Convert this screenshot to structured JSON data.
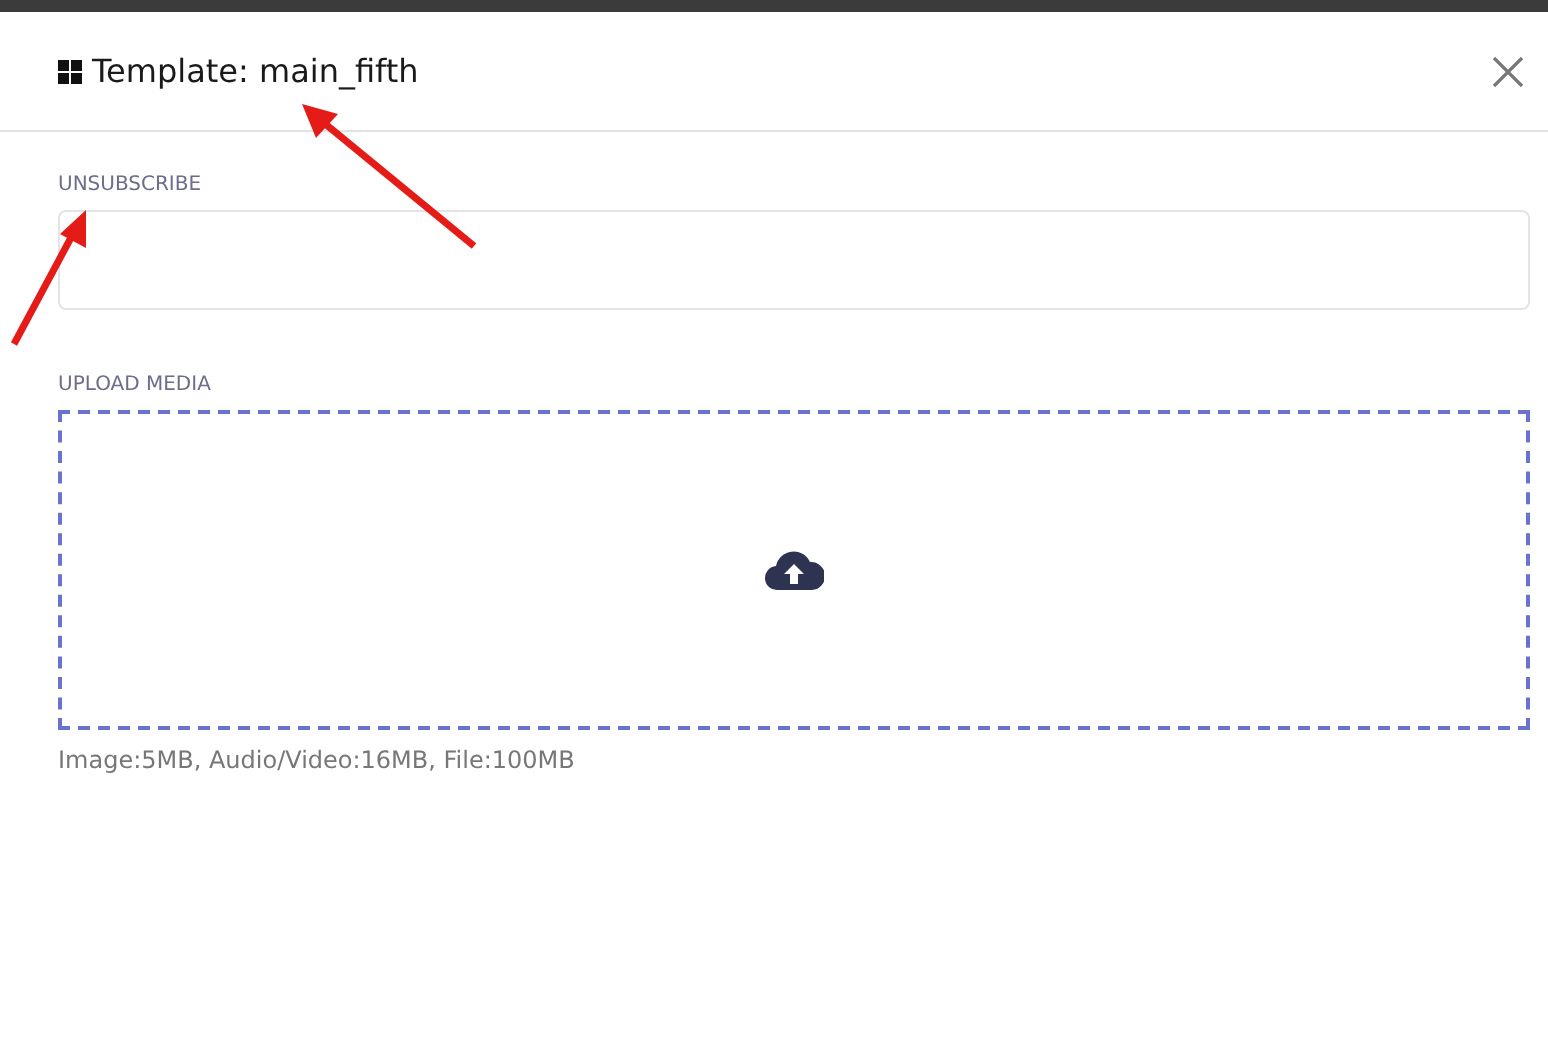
{
  "dialog": {
    "title": "Template: main_fifth"
  },
  "fields": [
    {
      "kind": "text",
      "label": "UNSUBSCRIBE"
    },
    {
      "kind": "upload",
      "label": "UPLOAD MEDIA",
      "hint": "Image:5MB, Audio/Video:16MB, File:100MB"
    }
  ]
}
